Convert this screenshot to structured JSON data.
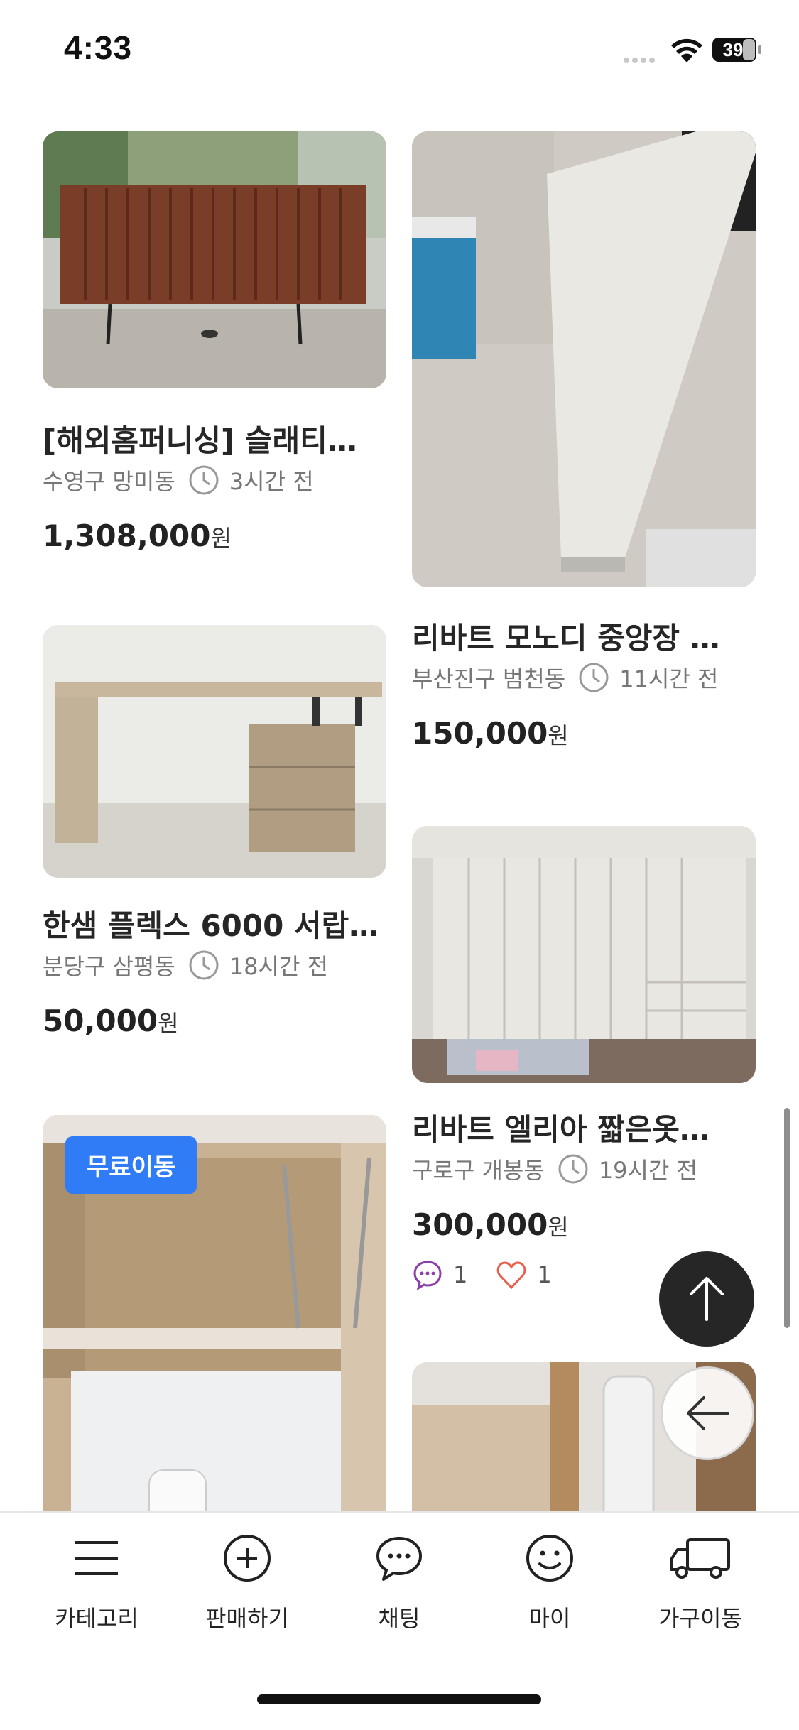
{
  "status": {
    "time": "4:33",
    "battery": "39"
  },
  "products": [
    {
      "title": "[해외홈퍼니싱] 슬래티…",
      "location": "수영구 망미동",
      "time_ago": "3시간 전",
      "price": "1,308,000",
      "currency": "원"
    },
    {
      "title": "리바트 모노디 중앙장 …",
      "location": "부산진구 범천동",
      "time_ago": "11시간 전",
      "price": "150,000",
      "currency": "원"
    },
    {
      "title": "한샘 플렉스 6000 서랍…",
      "location": "분당구 삼평동",
      "time_ago": "18시간 전",
      "price": "50,000",
      "currency": "원"
    },
    {
      "title": "리바트 엘리아 짧은옷…",
      "location": "구로구 개봉동",
      "time_ago": "19시간 전",
      "price": "300,000",
      "currency": "원",
      "chats": "1",
      "likes": "1"
    },
    {
      "badge": "무료이동"
    }
  ],
  "nav": [
    {
      "label": "카테고리",
      "icon": "menu-icon"
    },
    {
      "label": "판매하기",
      "icon": "plus-circle-icon"
    },
    {
      "label": "채팅",
      "icon": "chat-icon"
    },
    {
      "label": "마이",
      "icon": "smile-icon"
    },
    {
      "label": "가구이동",
      "icon": "truck-icon"
    }
  ],
  "colors": {
    "badge": "#2f7cf6",
    "fab": "#262626",
    "heart": "#e8604c",
    "chat": "#8b3fa8"
  }
}
